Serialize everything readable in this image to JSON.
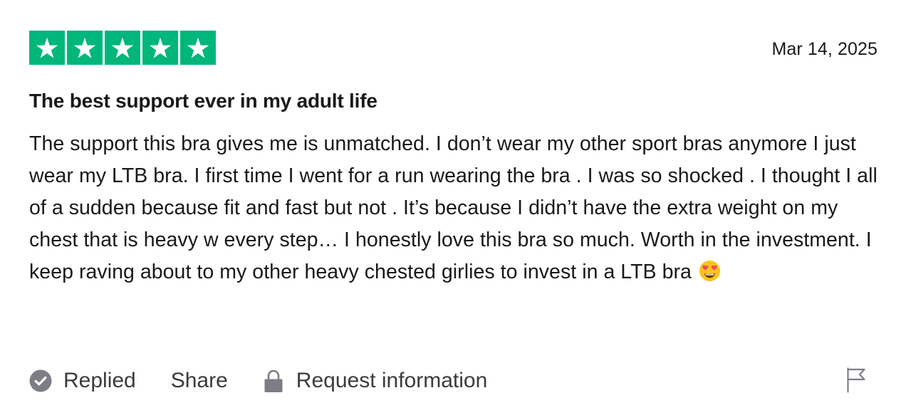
{
  "review": {
    "rating": 5,
    "rating_max": 5,
    "date": "Mar 14, 2025",
    "title": "The best support ever in my adult life",
    "body": "The support this bra gives me is unmatched. I don’t wear my other sport bras anymore I just wear my LTB bra. I first time I went for a run wearing the bra . I was so shocked . I thought I all of a sudden because fit and fast but not . It’s because I didn’t have the extra weight on my chest that is heavy w every step… I honestly love this bra so much. Worth in the investment. I keep raving about to my other heavy chested girlies to invest in a LTB bra",
    "body_emoji": "smiling-face-with-heart-eyes"
  },
  "actions": {
    "replied_label": "Replied",
    "share_label": "Share",
    "request_info_label": "Request information"
  },
  "colors": {
    "star_green": "#00b67a",
    "text": "#191919",
    "muted_icon": "#7d7d87"
  },
  "icons": {
    "star": "star-icon",
    "replied": "check-circle-icon",
    "lock": "lock-icon",
    "flag": "flag-icon"
  }
}
